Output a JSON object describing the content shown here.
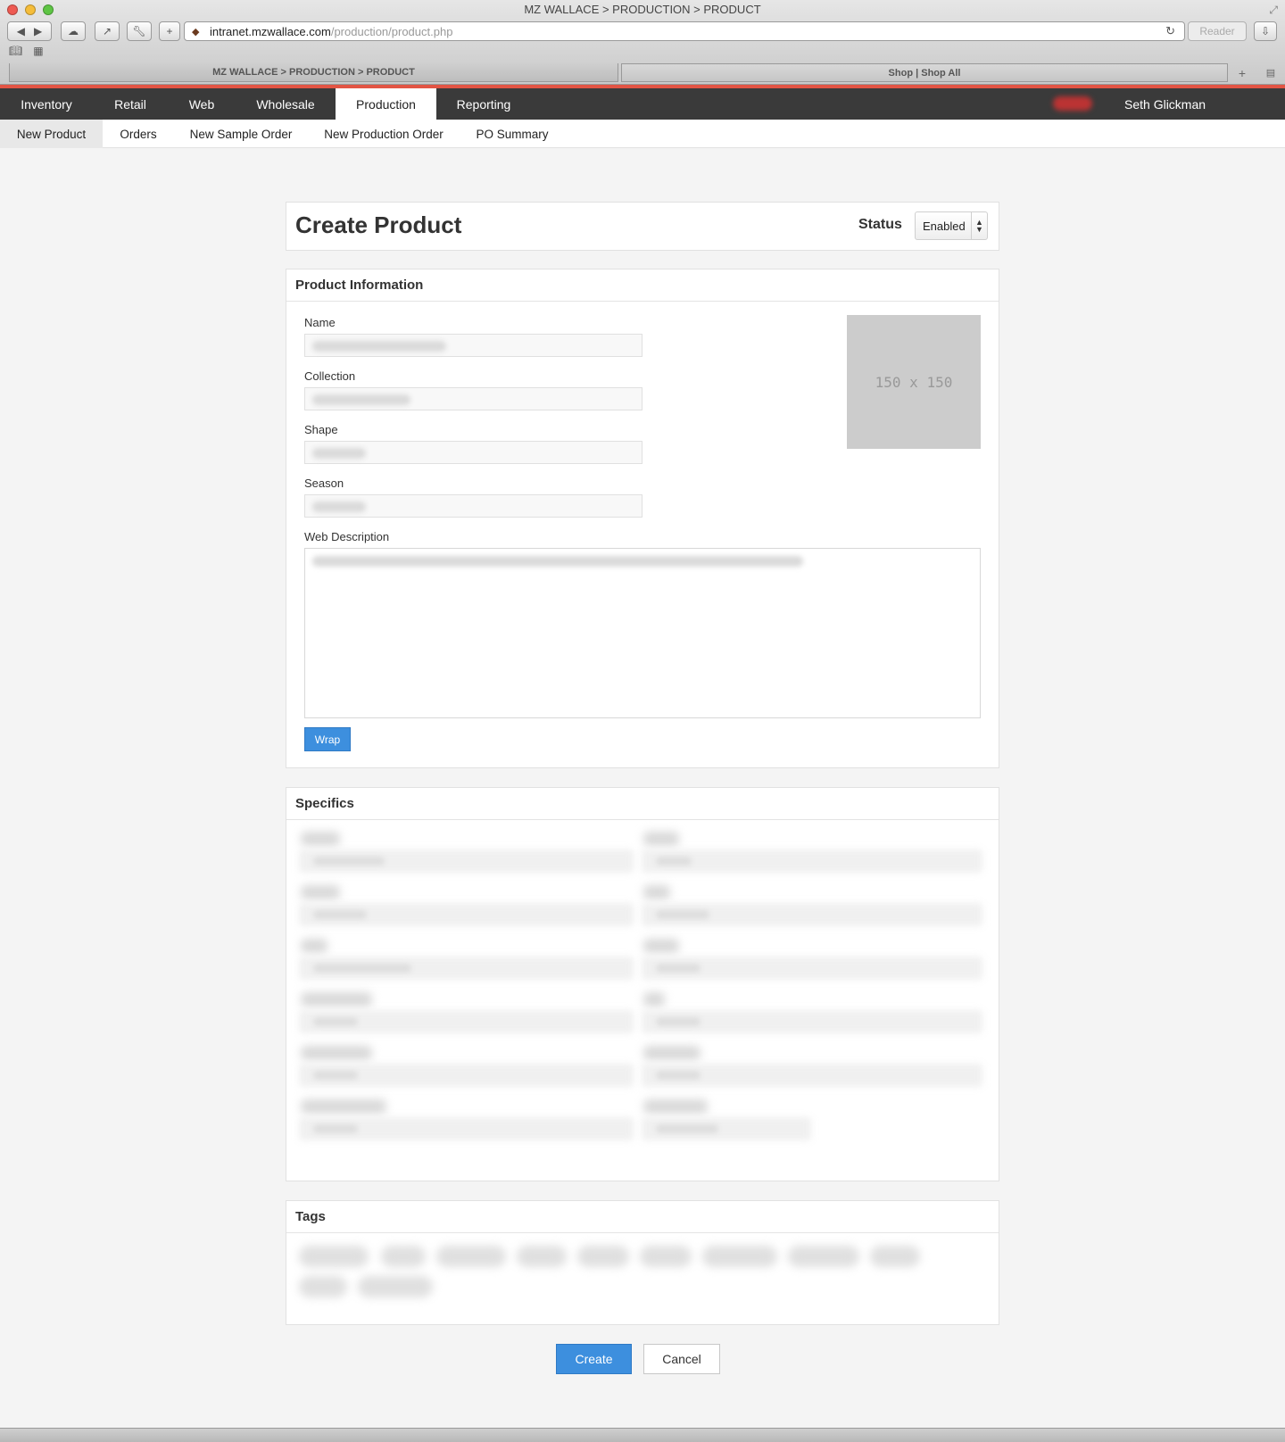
{
  "browser": {
    "window_title": "MZ WALLACE > PRODUCTION > PRODUCT",
    "url_host": "intranet.mzwallace.com",
    "url_path": "/production/product.php",
    "reader_label": "Reader",
    "tabs": [
      {
        "label": "MZ WALLACE > PRODUCTION > PRODUCT"
      },
      {
        "label": "Shop | Shop All"
      }
    ]
  },
  "nav": {
    "items": [
      {
        "label": "Inventory"
      },
      {
        "label": "Retail"
      },
      {
        "label": "Web"
      },
      {
        "label": "Wholesale"
      },
      {
        "label": "Production"
      },
      {
        "label": "Reporting"
      }
    ],
    "active": "Production",
    "user_name": "Seth Glickman"
  },
  "subnav": {
    "items": [
      {
        "label": "New Product"
      },
      {
        "label": "Orders"
      },
      {
        "label": "New Sample Order"
      },
      {
        "label": "New Production Order"
      },
      {
        "label": "PO Summary"
      }
    ],
    "active": "New Product"
  },
  "header": {
    "title": "Create Product",
    "status_label": "Status",
    "status_value": "Enabled"
  },
  "product_info": {
    "heading": "Product Information",
    "fields": [
      {
        "label": "Name"
      },
      {
        "label": "Collection"
      },
      {
        "label": "Shape"
      },
      {
        "label": "Season"
      }
    ],
    "web_description_label": "Web Description",
    "image_placeholder": "150 x 150",
    "wrap_label": "Wrap"
  },
  "specifics": {
    "heading": "Specifics"
  },
  "tags": {
    "heading": "Tags"
  },
  "actions": {
    "create_label": "Create",
    "cancel_label": "Cancel"
  },
  "colors": {
    "accent": "#e25444",
    "nav_bg": "#3a3a3a",
    "primary_button": "#3d8fde"
  }
}
